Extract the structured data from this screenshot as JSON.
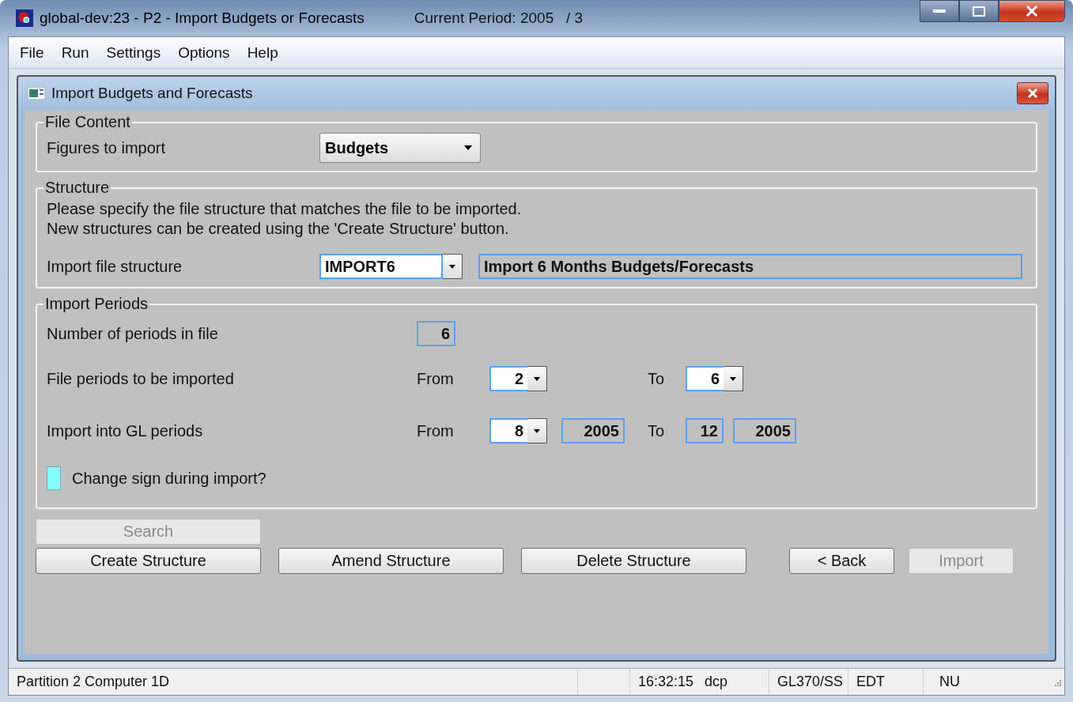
{
  "window": {
    "title": "global-dev:23 - P2 - Import Budgets or Forecasts",
    "period": "Current Period: 2005   / 3"
  },
  "menu": [
    "File",
    "Run",
    "Settings",
    "Options",
    "Help"
  ],
  "dialog": {
    "title": "Import Budgets and Forecasts"
  },
  "file_content": {
    "legend": "File Content",
    "label": "Figures to import",
    "value": "Budgets"
  },
  "structure": {
    "legend": "Structure",
    "instructions": [
      "Please specify the file structure that matches the file to be imported.",
      "New structures can be created using the 'Create Structure' button."
    ],
    "label": "Import file structure",
    "code": "IMPORT6",
    "description": "Import 6 Months Budgets/Forecasts"
  },
  "periods": {
    "legend": "Import Periods",
    "count_label": "Number of periods in file",
    "count": "6",
    "rows": [
      {
        "label": "File periods to be imported",
        "from_label": "From",
        "from": [
          {
            "kind": "dropdown",
            "value": "2"
          }
        ],
        "to_label": "To",
        "to": [
          {
            "kind": "dropdown",
            "value": "6"
          }
        ]
      },
      {
        "label": "Import into GL periods",
        "from_label": "From",
        "from": [
          {
            "kind": "dropdown",
            "value": "8"
          },
          {
            "kind": "year",
            "value": "2005"
          }
        ],
        "to_label": "To",
        "to": [
          {
            "kind": "period",
            "value": "12"
          },
          {
            "kind": "year",
            "value": "2005"
          }
        ]
      }
    ],
    "change_sign": {
      "label": "Change sign during import?",
      "checked": false
    }
  },
  "search_button": {
    "label": "Search",
    "disabled": true
  },
  "buttons": [
    {
      "label": "Create Structure",
      "disabled": false
    },
    {
      "label": "Amend Structure",
      "disabled": false
    },
    {
      "label": "Delete Structure",
      "disabled": false
    },
    {
      "label": "< Back",
      "disabled": false
    },
    {
      "label": "Import",
      "disabled": true
    }
  ],
  "status_bar": [
    "Partition 2 Computer 1D",
    "16:32:15",
    "dcp",
    "GL370/SS",
    "EDT",
    "NU"
  ]
}
